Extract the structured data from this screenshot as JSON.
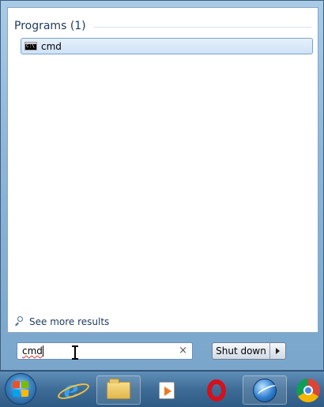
{
  "start_menu": {
    "group": {
      "title": "Programs (1)"
    },
    "results": [
      {
        "label": "cmd",
        "icon": "command-prompt-icon"
      }
    ],
    "see_more": {
      "label": "See more results"
    },
    "search": {
      "value": "cmd",
      "clear_glyph": "×"
    },
    "shutdown": {
      "label": "Shut down"
    }
  },
  "taskbar": {
    "items": [
      {
        "name": "start-button",
        "icon": "windows-flag-icon"
      },
      {
        "name": "internet-explorer",
        "icon": "internet-explorer-icon"
      },
      {
        "name": "windows-explorer",
        "icon": "folder-icon",
        "active": true
      },
      {
        "name": "media-player",
        "icon": "media-player-icon"
      },
      {
        "name": "opera",
        "icon": "opera-icon"
      },
      {
        "name": "seamonkey",
        "icon": "browser-globe-icon",
        "active": true
      },
      {
        "name": "chrome",
        "icon": "chrome-icon"
      }
    ]
  },
  "colors": {
    "group_title": "#1e395b",
    "selection_border": "#7da2ce",
    "taskbar": "#3e6c96"
  }
}
